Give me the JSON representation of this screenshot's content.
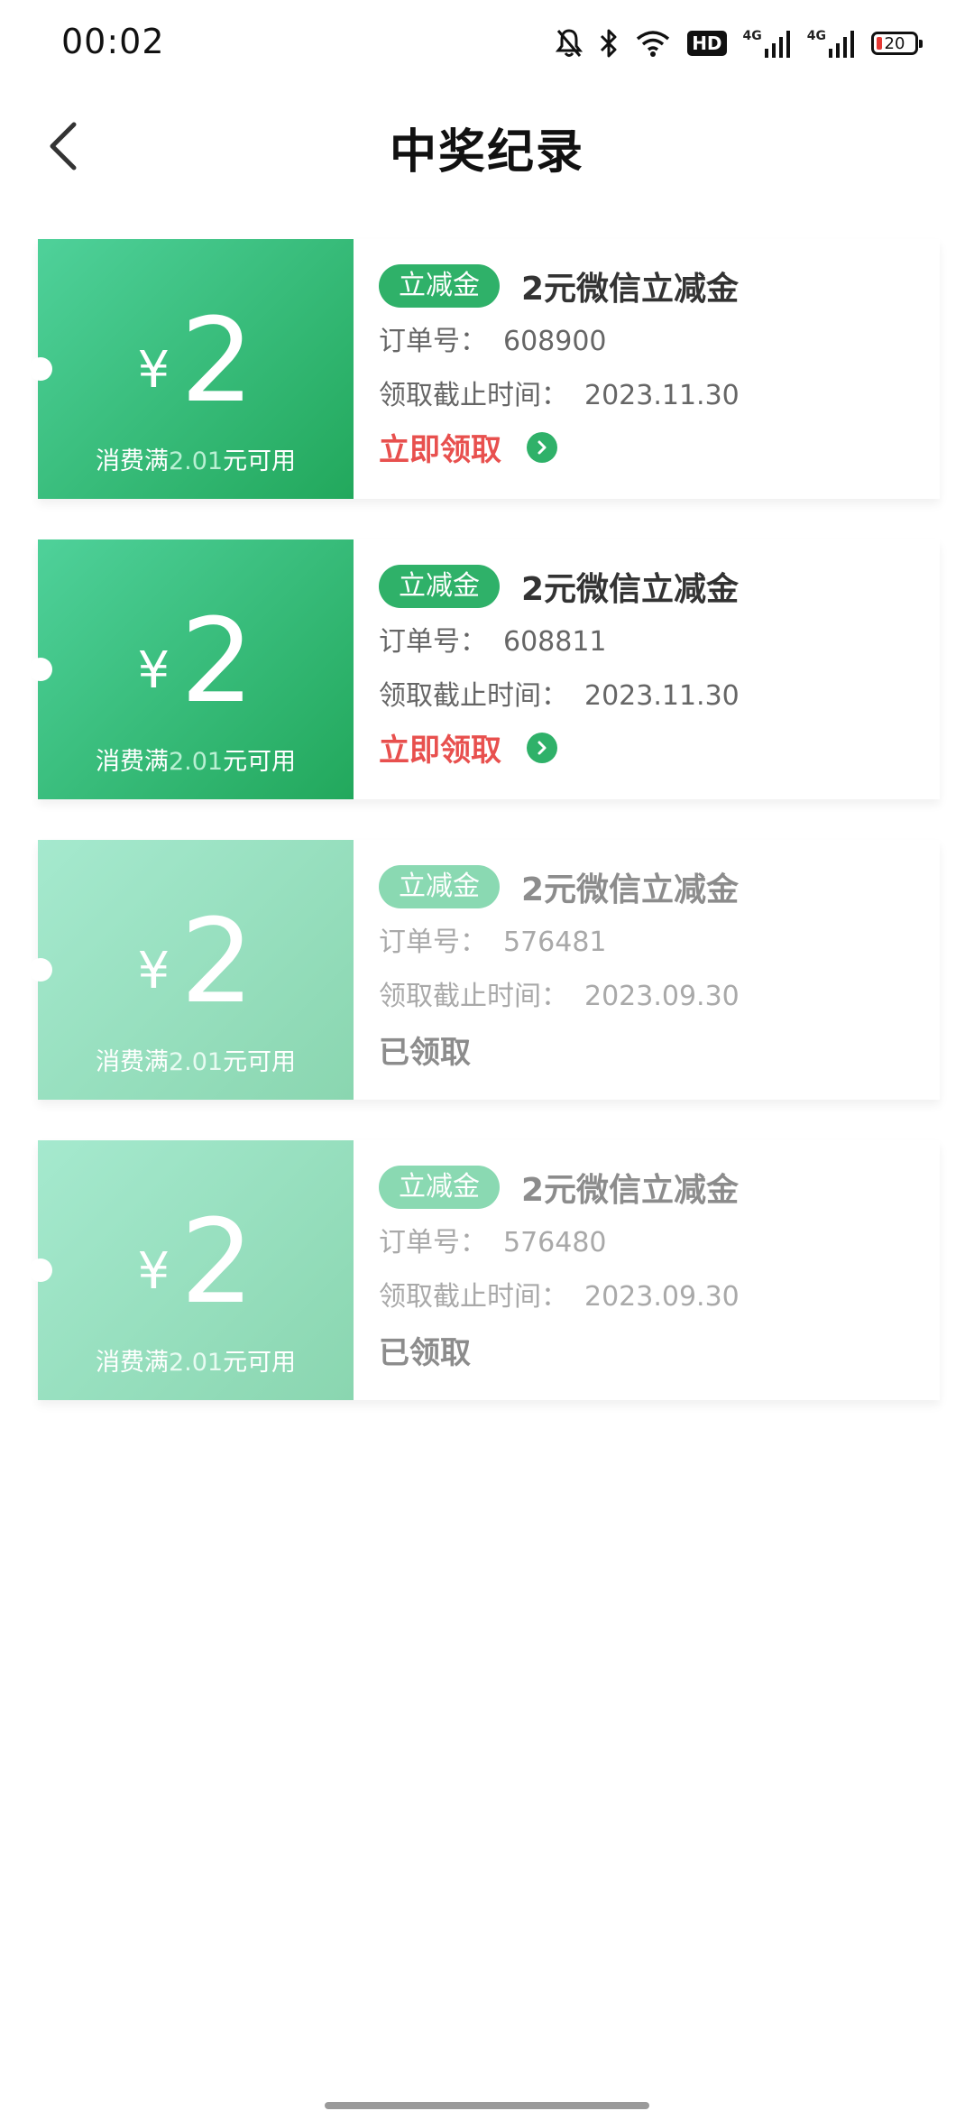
{
  "status_bar": {
    "time": "00:02",
    "network_hd": "HD",
    "signal1_label": "4G",
    "signal2_label": "4G",
    "battery": "20"
  },
  "header": {
    "title": "中奖纪录"
  },
  "coupons": [
    {
      "currency": "¥",
      "amount": "2",
      "condition_prefix": "消费满",
      "condition_value": "2.01",
      "condition_suffix": "元可用",
      "tag": "立减金",
      "title": "2元微信立减金",
      "order_label": "订单号：",
      "order_no": "608900",
      "deadline_label": "领取截止时间：",
      "deadline": "2023.11.30",
      "action": "立即领取",
      "status": "active"
    },
    {
      "currency": "¥",
      "amount": "2",
      "condition_prefix": "消费满",
      "condition_value": "2.01",
      "condition_suffix": "元可用",
      "tag": "立减金",
      "title": "2元微信立减金",
      "order_label": "订单号：",
      "order_no": "608811",
      "deadline_label": "领取截止时间：",
      "deadline": "2023.11.30",
      "action": "立即领取",
      "status": "active"
    },
    {
      "currency": "¥",
      "amount": "2",
      "condition_prefix": "消费满",
      "condition_value": "2.01",
      "condition_suffix": "元可用",
      "tag": "立减金",
      "title": "2元微信立减金",
      "order_label": "订单号：",
      "order_no": "576481",
      "deadline_label": "领取截止时间：",
      "deadline": "2023.09.30",
      "action": "已领取",
      "status": "claimed"
    },
    {
      "currency": "¥",
      "amount": "2",
      "condition_prefix": "消费满",
      "condition_value": "2.01",
      "condition_suffix": "元可用",
      "tag": "立减金",
      "title": "2元微信立减金",
      "order_label": "订单号：",
      "order_no": "576480",
      "deadline_label": "领取截止时间：",
      "deadline": "2023.09.30",
      "action": "已领取",
      "status": "claimed"
    }
  ],
  "colors": {
    "brand_green": "#2fb169",
    "claim_red": "#e8504e",
    "used_green": "#8ad9b2"
  },
  "icons": {
    "back": "chevron-left-icon",
    "claim_arrow": "chevron-right-circle-icon"
  }
}
